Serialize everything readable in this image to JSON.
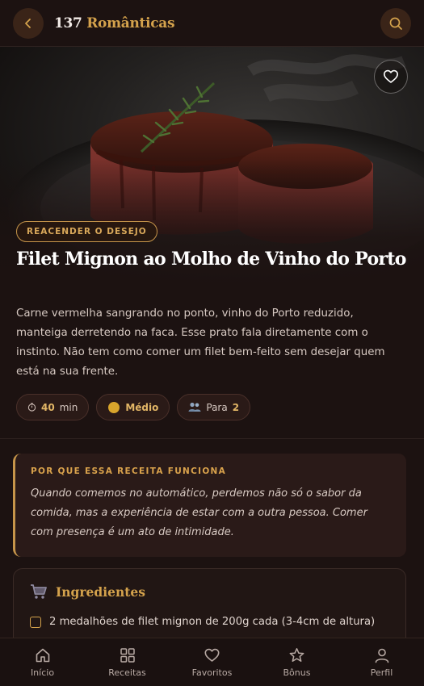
{
  "header": {
    "title_number": "137",
    "title_word": "Românticas",
    "back_icon": "chevron-left-icon",
    "search_icon": "search-icon"
  },
  "hero": {
    "tag": "REACENDER O DESEJO",
    "title": "Filet Mignon ao Molho de Vinho do Porto",
    "favorite_icon": "heart-icon"
  },
  "description": "Carne vermelha sangrando no ponto, vinho do Porto reduzido, manteiga derretendo na faca. Esse prato fala diretamente com o instinto. Não tem como comer um filet bem-feito sem desejar quem está na sua frente.",
  "chips": {
    "time_value": "40",
    "time_unit": "min",
    "difficulty": "Médio",
    "serves_label": "Para",
    "serves_value": "2"
  },
  "why": {
    "heading": "POR QUE ESSA RECEITA FUNCIONA",
    "text": "Quando comemos no automático, perdemos não só o sabor da comida, mas a experiência de estar com a outra pessoa. Comer com presença é um ato de intimidade."
  },
  "ingredients": {
    "heading": "Ingredientes",
    "items": [
      "2 medalhões de filet mignon de 200g cada (3-4cm de altura)"
    ]
  },
  "nav": [
    {
      "label": "Início",
      "icon": "home-icon"
    },
    {
      "label": "Receitas",
      "icon": "grid-icon"
    },
    {
      "label": "Favoritos",
      "icon": "heart-icon"
    },
    {
      "label": "Bônus",
      "icon": "star-icon"
    },
    {
      "label": "Perfil",
      "icon": "user-icon"
    }
  ],
  "colors": {
    "background": "#1c1211",
    "accent": "#d4a24c",
    "card": "#2a1a18"
  }
}
